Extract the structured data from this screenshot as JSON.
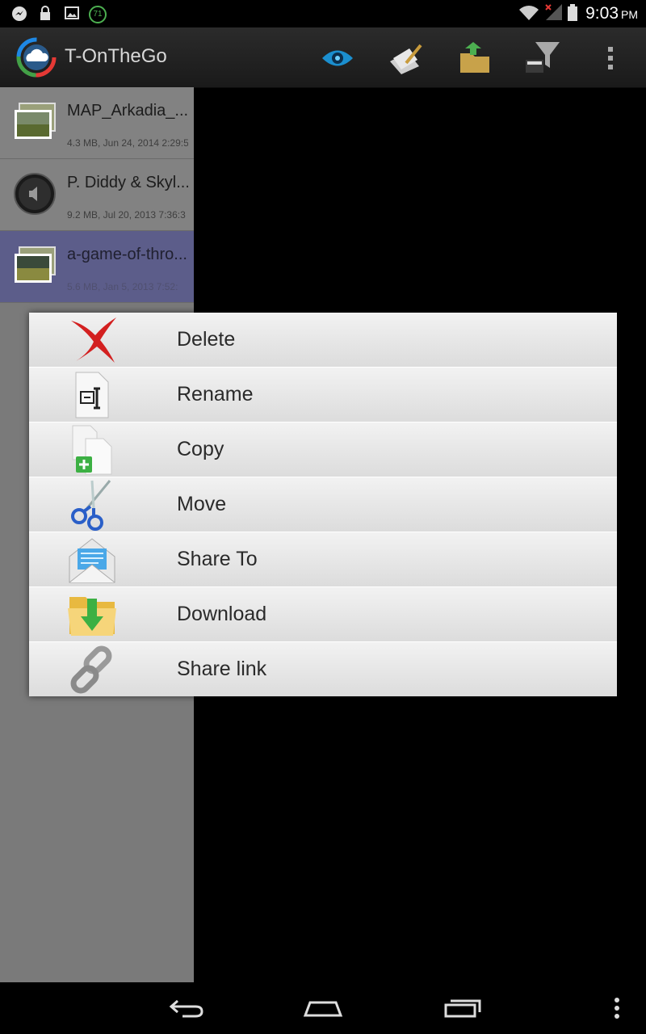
{
  "status_bar": {
    "time": "9:03",
    "ampm": "PM",
    "notification_badge": "71",
    "icons": [
      "messenger-icon",
      "lock-icon",
      "image-icon",
      "badge-icon",
      "wifi-icon",
      "signal-icon",
      "battery-icon"
    ]
  },
  "action_bar": {
    "title": "T-OnTheGo",
    "actions": [
      "eye-icon",
      "edit-icon",
      "upload-icon",
      "filter-icon",
      "overflow-menu-icon"
    ]
  },
  "files": [
    {
      "name": "MAP_Arkadia_...",
      "meta": "4.3 MB, Jun 24, 2014 2:29:5",
      "type": "image",
      "selected": false
    },
    {
      "name": "P. Diddy & Skyl...",
      "meta": "9.2 MB, Jul 20, 2013 7:36:3",
      "type": "audio",
      "selected": false
    },
    {
      "name": "a-game-of-thro...",
      "meta": "5.6 MB, Jan 5, 2013 7:52:",
      "type": "image",
      "selected": true
    }
  ],
  "context_menu": {
    "items": [
      {
        "label": "Delete",
        "icon": "delete-icon"
      },
      {
        "label": "Rename",
        "icon": "rename-icon"
      },
      {
        "label": "Copy",
        "icon": "copy-icon"
      },
      {
        "label": "Move",
        "icon": "scissors-icon"
      },
      {
        "label": "Share To",
        "icon": "mail-icon"
      },
      {
        "label": "Download",
        "icon": "download-folder-icon"
      },
      {
        "label": "Share link",
        "icon": "link-icon"
      }
    ]
  },
  "nav_bar": [
    "back-icon",
    "home-icon",
    "recents-icon",
    "overflow-icon"
  ]
}
